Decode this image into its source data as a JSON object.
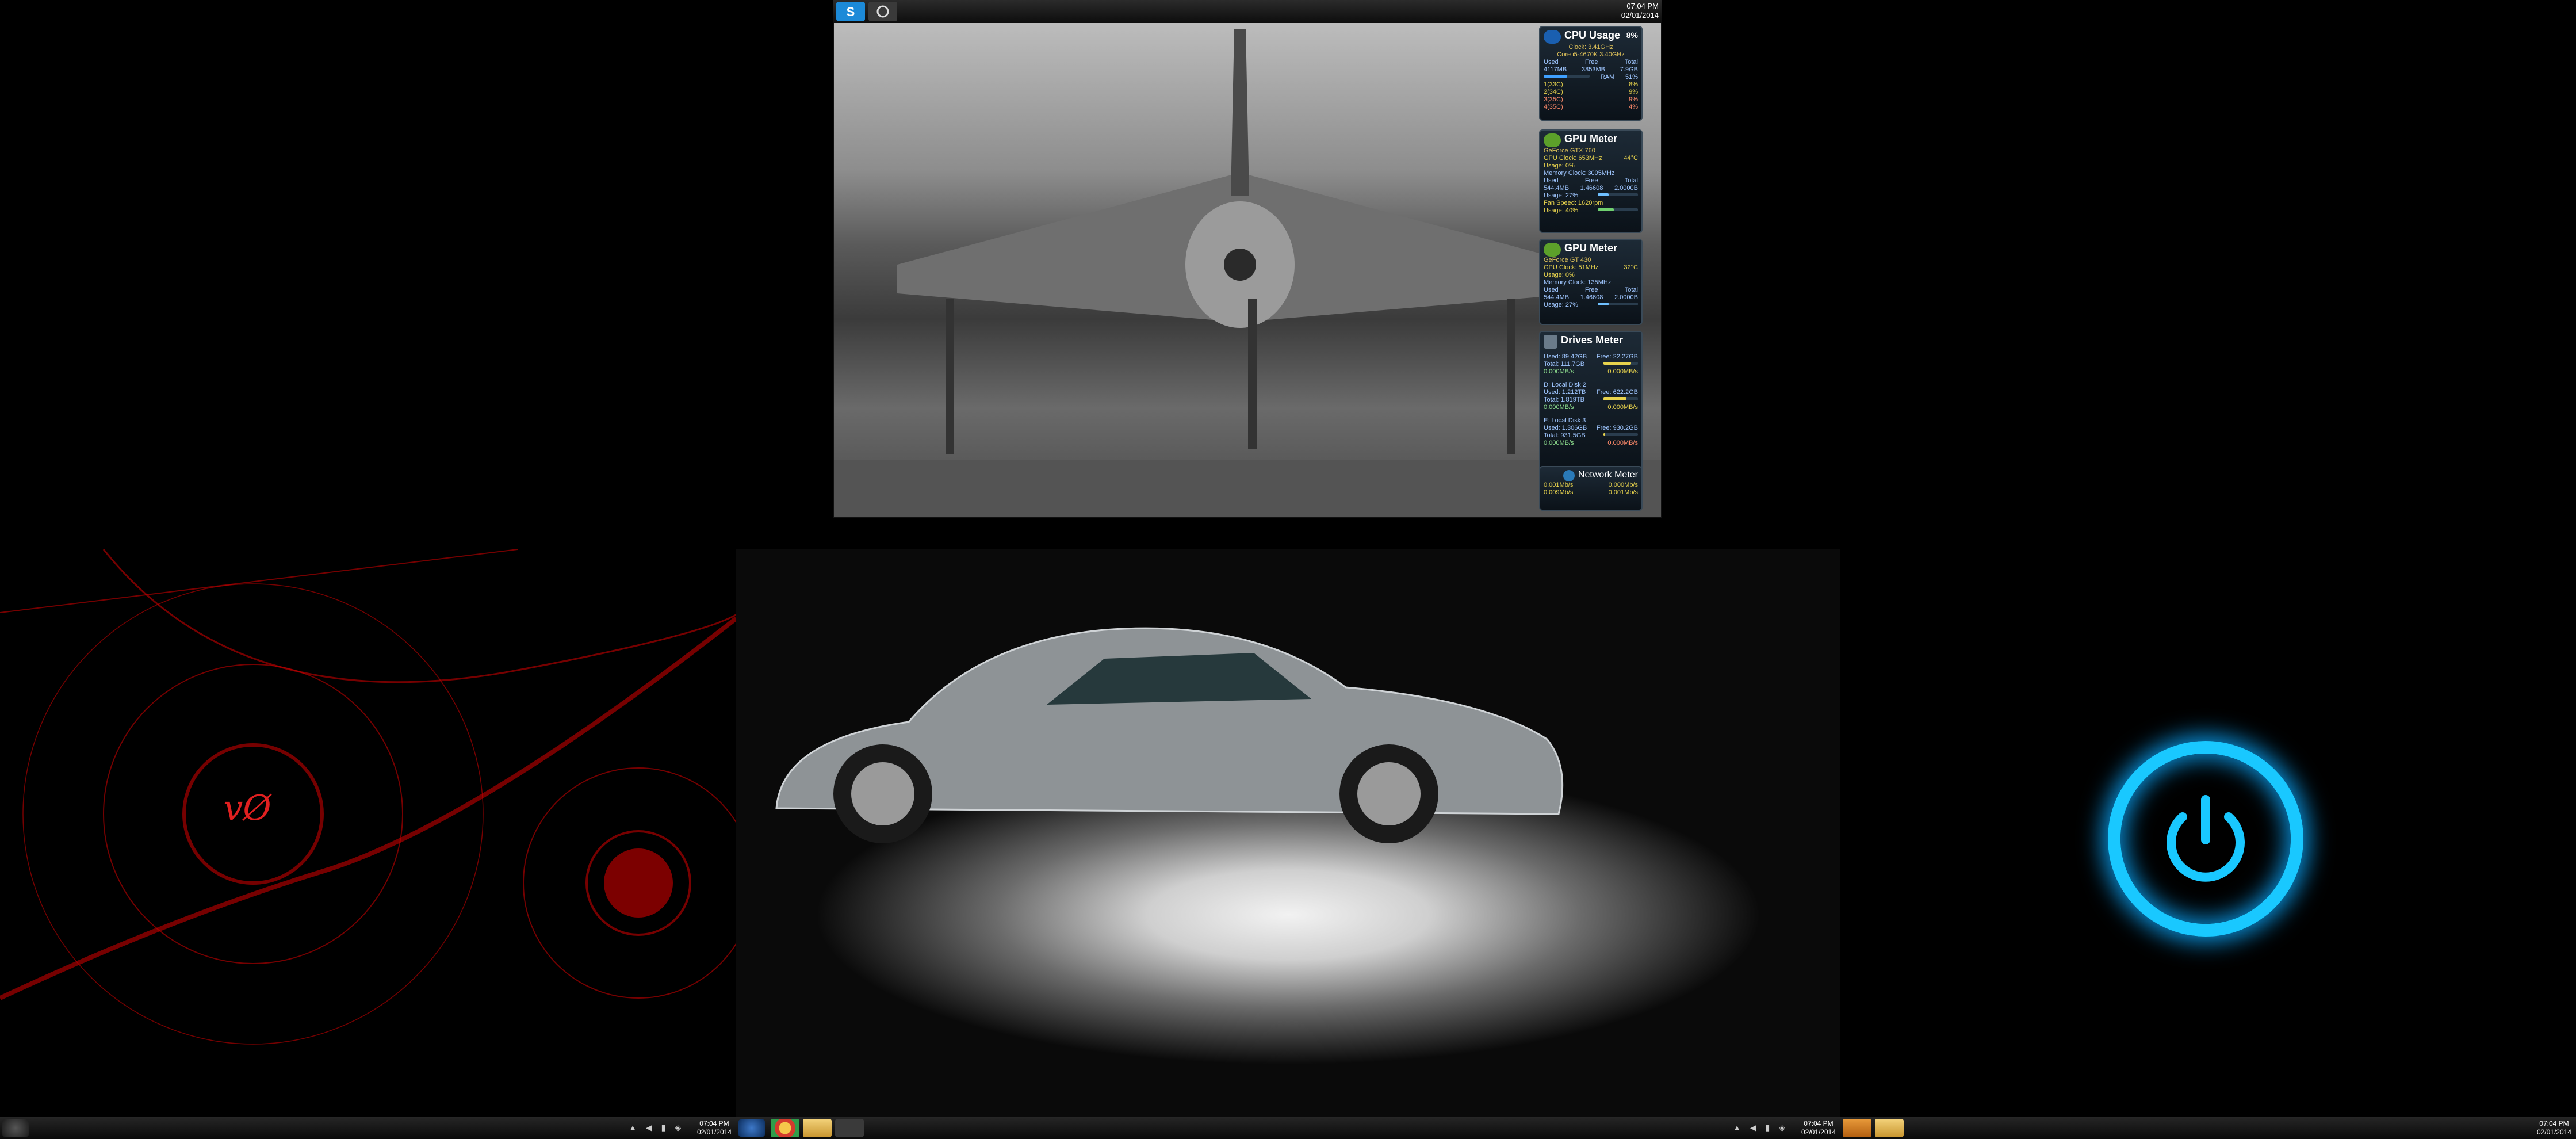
{
  "top_monitor": {
    "clock": {
      "time": "07:04 PM",
      "date": "02/01/2014"
    },
    "taskbar_icons": [
      "skype-icon",
      "steam-icon"
    ]
  },
  "gadgets": {
    "cpu": {
      "title": "CPU Usage",
      "percent": "8%",
      "clock": "Clock: 3.41GHz",
      "model": "Core i5-4670K 3.40GHz",
      "ram_headers": [
        "Used",
        "Free",
        "Total"
      ],
      "ram_values": [
        "4117MB",
        "3853MB",
        "7.9GB"
      ],
      "ram_label": "RAM",
      "ram_percent": "51%",
      "cores": [
        {
          "label": "1(33C)",
          "value": "8%"
        },
        {
          "label": "2(34C)",
          "value": "9%"
        },
        {
          "label": "3(35C)",
          "value": "9%"
        },
        {
          "label": "4(35C)",
          "value": "4%"
        }
      ]
    },
    "gpu1": {
      "title": "GPU Meter",
      "model": "GeForce GTX 760",
      "clock_label": "GPU Clock: 653MHz",
      "temp": "44°C",
      "usage": "Usage: 0%",
      "mem_clock": "Memory Clock: 3005MHz",
      "mem_headers": [
        "Used",
        "Free",
        "Total"
      ],
      "mem_values": [
        "544.4MB",
        "1.46608",
        "2.0000B"
      ],
      "usage_mem": "Usage: 27%",
      "fan": "Fan Speed: 1620rpm",
      "usage_fan": "Usage: 40%"
    },
    "gpu2": {
      "title": "GPU Meter",
      "model": "GeForce GT 430",
      "clock_label": "GPU Clock: 51MHz",
      "temp": "32°C",
      "usage": "Usage: 0%",
      "mem_clock": "Memory Clock: 135MHz",
      "mem_headers": [
        "Used",
        "Free",
        "Total"
      ],
      "mem_values": [
        "544.4MB",
        "1.46608",
        "2.0000B"
      ],
      "usage_mem": "Usage: 27%"
    },
    "drives": {
      "title": "Drives Meter",
      "disks": [
        {
          "name": "Used: 89.42GB",
          "free": "Free: 22.27GB",
          "total": "Total: 111.7GB",
          "read": "0.000MB/s",
          "write": "0.000MB/s"
        },
        {
          "name": "D: Local Disk 2",
          "used": "Used: 1.212TB",
          "free": "Free: 622.2GB",
          "total": "Total: 1.819TB",
          "read": "0.000MB/s",
          "write": "0.000MB/s"
        },
        {
          "name": "E: Local Disk 3",
          "used": "Used: 1.306GB",
          "free": "Free: 930.2GB",
          "total": "Total: 931.5GB",
          "read": "0.000MB/s",
          "write": "0.000MB/s"
        }
      ]
    },
    "network": {
      "title": "Network Meter",
      "row1": [
        "0.001Mb/s",
        "0.000Mb/s"
      ],
      "row2": [
        "0.009Mb/s",
        "0.001Mb/s"
      ]
    }
  },
  "left_monitor": {
    "clock": {
      "time": "07:04 PM",
      "date": "02/01/2014"
    }
  },
  "center_monitor": {
    "clock": {
      "time": "07:04 PM",
      "date": "02/01/2014"
    },
    "taskbar_icons": [
      "windows-media-icon",
      "chrome-icon",
      "folder-icon",
      "steam-icon"
    ]
  },
  "right_monitor": {
    "clock": {
      "time": "07:04 PM",
      "date": "02/01/2014"
    },
    "taskbar_icons": [
      "media-player-icon",
      "folder-icon"
    ]
  }
}
